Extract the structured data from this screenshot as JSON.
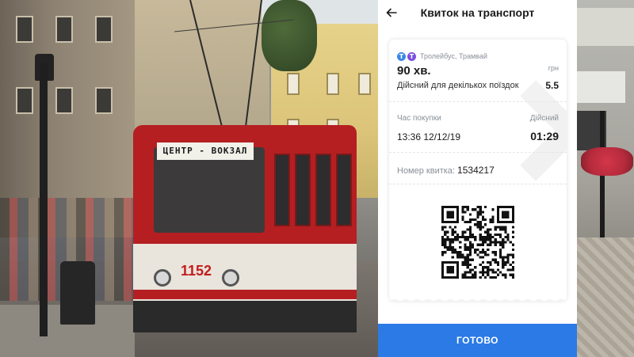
{
  "header": {
    "title": "Квиток на транспорт",
    "back_icon": "arrow-left-icon"
  },
  "ticket": {
    "transport_types": [
      {
        "icon": "trolleybus-icon",
        "glyph": "T",
        "color": "#3a86e8"
      },
      {
        "icon": "tram-icon",
        "glyph": "T",
        "color": "#7b4fe0"
      }
    ],
    "transport_label": "Тролейбус, Трамвай",
    "duration": "90 хв.",
    "currency": "грн",
    "validity": "Дійсний для декількох поїздок",
    "price": "5.5",
    "purchase_time_label": "Час покупки",
    "valid_label": "Дійсний",
    "purchase_time": "13:36 12/12/19",
    "remaining_time": "01:29",
    "ticket_number_label": "Номер квитка:",
    "ticket_number": "1534217"
  },
  "footer": {
    "done_label": "ГОТОВО"
  },
  "background": {
    "tram_sign": "ЦЕНТР - ВОКЗАЛ",
    "tram_number": "1152"
  },
  "colors": {
    "accent": "#2b7ae5",
    "tram_red": "#b51f22"
  }
}
